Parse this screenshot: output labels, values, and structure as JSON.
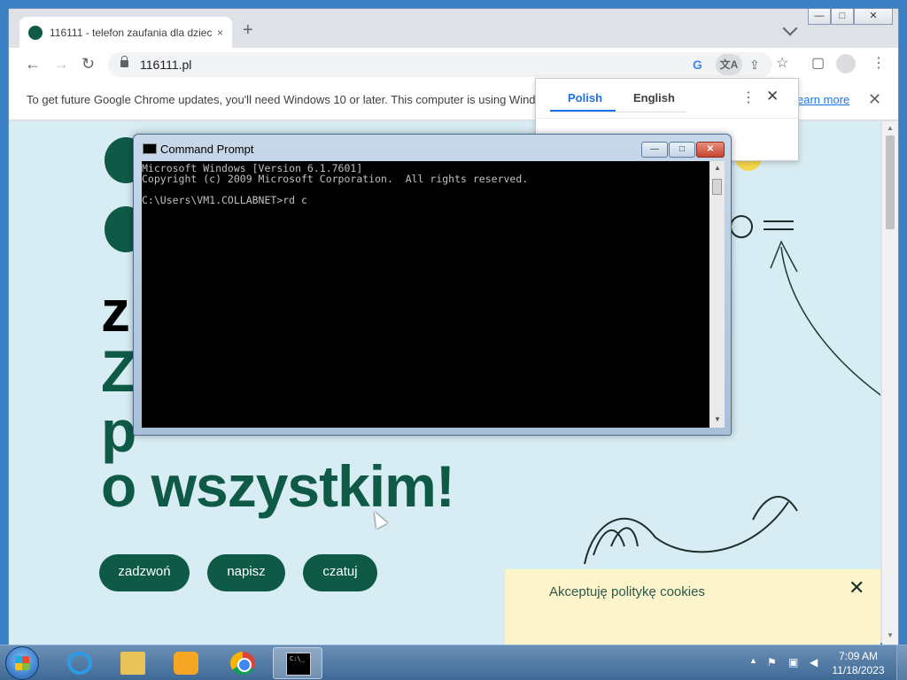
{
  "browser": {
    "tab": {
      "title": "116111 - telefon zaufania dla dzieci",
      "close": "×"
    },
    "new_tab": "+",
    "window_buttons": {
      "minimize": "—",
      "maximize": "□",
      "close": "✕"
    },
    "toolbar": {
      "back": "←",
      "forward": "→",
      "reload": "↻",
      "url": "116111.pl",
      "google_icon": "G",
      "translate_icon": "文A",
      "share_icon": "⇪",
      "bookmark_icon": "☆",
      "side_panel_icon": "▢",
      "menu_icon": "⋮"
    },
    "infobar": {
      "message": "To get future Google Chrome updates, you'll need Windows 10 or later. This computer is using Wind",
      "link": "earn more",
      "close": "✕"
    }
  },
  "translate_popup": {
    "tab_source": "Polish",
    "tab_target": "English",
    "more": "⋮",
    "close": "✕"
  },
  "webpage": {
    "hero_lines": [
      "z",
      "Z",
      "p",
      "o wszystkim!"
    ],
    "buttons": [
      "zadzwoń",
      "napisz",
      "czatuj"
    ],
    "cookie_text": "Akceptuję politykę cookies",
    "cookie_close": "✕",
    "brand_color": "#0e5a46",
    "background_color": "#d8ecf3"
  },
  "cmd": {
    "title": "Command Prompt",
    "buttons": {
      "minimize": "—",
      "maximize": "□",
      "close": "✕"
    },
    "lines": [
      "Microsoft Windows [Version 6.1.7601]",
      "Copyright (c) 2009 Microsoft Corporation.  All rights reserved.",
      "",
      "C:\\Users\\VM1.COLLABNET>rd c"
    ]
  },
  "taskbar": {
    "pinned": [
      "internet-explorer",
      "windows-explorer",
      "media-player",
      "google-chrome",
      "command-prompt"
    ],
    "active": "command-prompt",
    "tray_arrow": "▲",
    "clock": {
      "time": "7:09 AM",
      "date": "11/18/2023"
    }
  }
}
